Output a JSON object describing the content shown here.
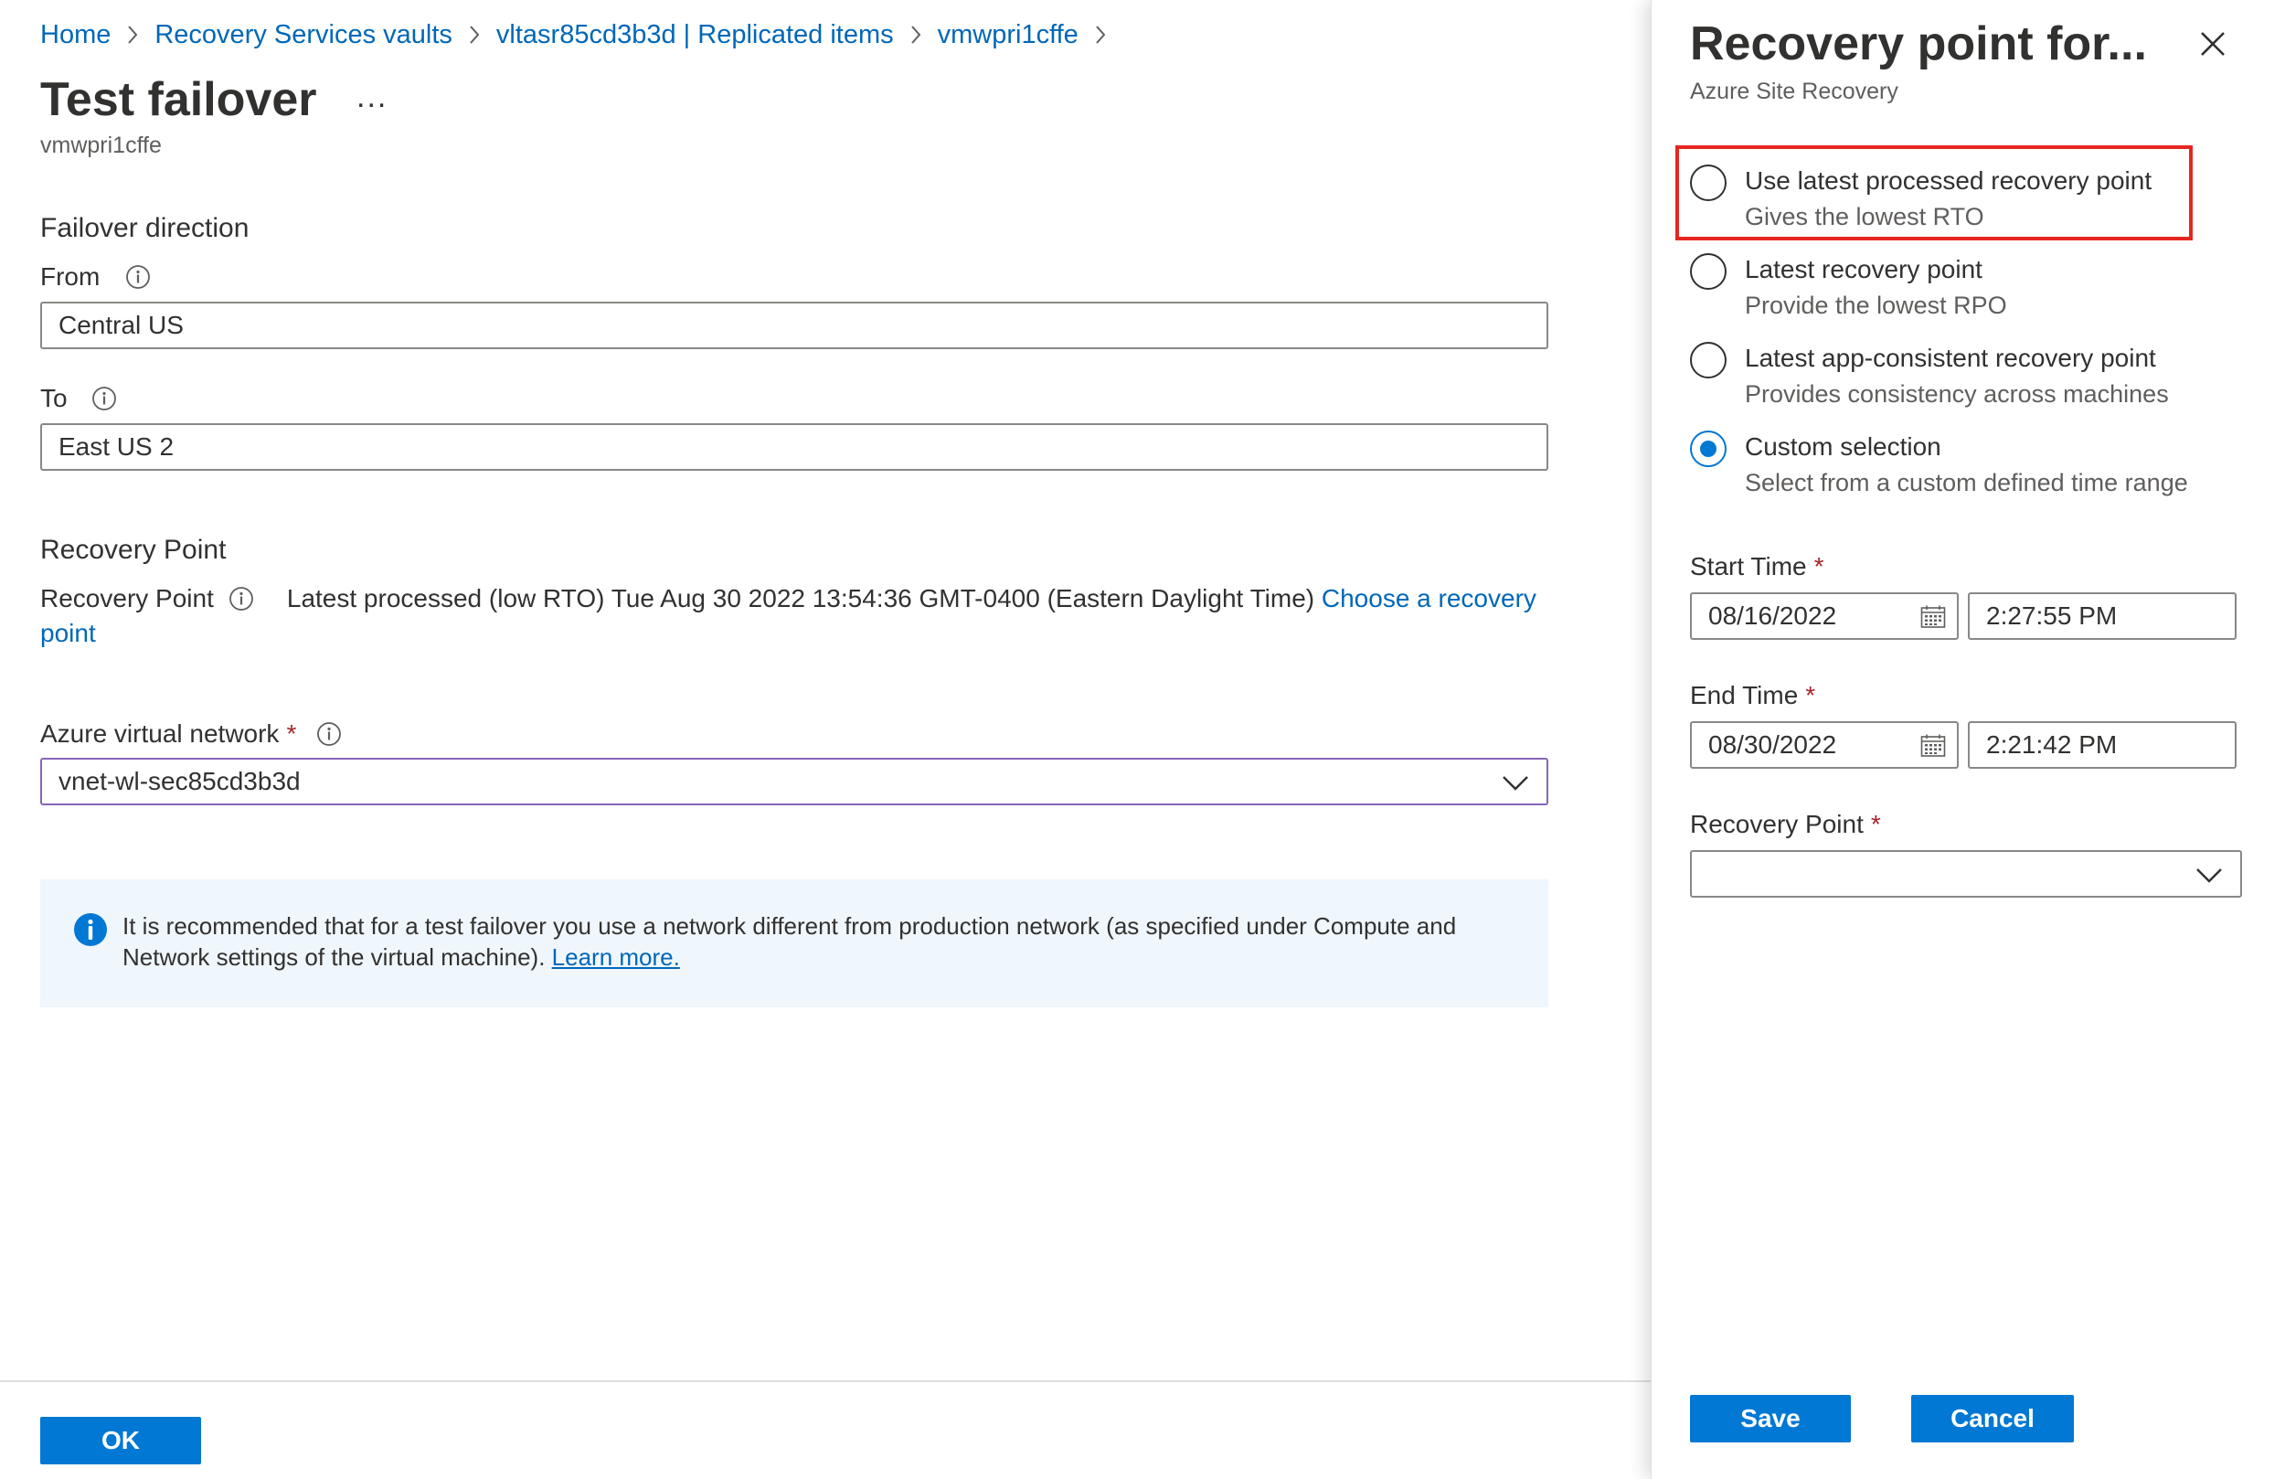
{
  "breadcrumb": {
    "items": [
      "Home",
      "Recovery Services vaults",
      "vltasr85cd3b3d | Replicated items",
      "vmwpri1cffe"
    ]
  },
  "main": {
    "title": "Test failover",
    "more_label": "...",
    "subtitle": "vmwpri1cffe",
    "failover_direction": {
      "heading": "Failover direction",
      "from_label": "From",
      "from_value": "Central US",
      "to_label": "To",
      "to_value": "East US 2"
    },
    "recovery_point": {
      "heading": "Recovery Point",
      "label": "Recovery Point",
      "value": "Latest processed (low RTO) Tue Aug 30 2022 13:54:36 GMT-0400 (Eastern Daylight Time)",
      "link": "Choose a recovery point"
    },
    "network": {
      "label": "Azure virtual network",
      "required_mark": "*",
      "value": "vnet-wl-sec85cd3b3d"
    },
    "info_bar": {
      "text": "It is recommended that for a test failover you use a network different from production network (as specified under Compute and Network settings of the virtual machine).",
      "link": "Learn more."
    },
    "ok_label": "OK"
  },
  "panel": {
    "title": "Recovery point for...",
    "subtitle": "Azure Site Recovery",
    "options": [
      {
        "label": "Use latest processed recovery point",
        "desc": "Gives the lowest RTO",
        "checked": false
      },
      {
        "label": "Latest recovery point",
        "desc": "Provide the lowest RPO",
        "checked": false
      },
      {
        "label": "Latest app-consistent recovery point",
        "desc": "Provides consistency across machines",
        "checked": false
      },
      {
        "label": "Custom selection",
        "desc": "Select from a custom defined time range",
        "checked": true
      }
    ],
    "start_time": {
      "label": "Start Time",
      "required_mark": "*",
      "date": "08/16/2022",
      "time": "2:27:55 PM"
    },
    "end_time": {
      "label": "End Time",
      "required_mark": "*",
      "date": "08/30/2022",
      "time": "2:21:42 PM"
    },
    "recovery_point": {
      "label": "Recovery Point",
      "required_mark": "*",
      "value": ""
    },
    "save_label": "Save",
    "cancel_label": "Cancel"
  },
  "colors": {
    "accent": "#0078d4",
    "link": "#0067b8",
    "required": "#a4262c",
    "highlight": "#e5261f",
    "info_background": "#eff6fc",
    "dropdown_focus_border": "#8764b8"
  },
  "icons": {
    "breadcrumb_separator": "chevron-right-icon",
    "field_info": "info-icon",
    "dropdown": "chevron-down-icon",
    "info_bar": "info-filled-icon",
    "close": "close-icon",
    "date_picker": "calendar-icon"
  }
}
